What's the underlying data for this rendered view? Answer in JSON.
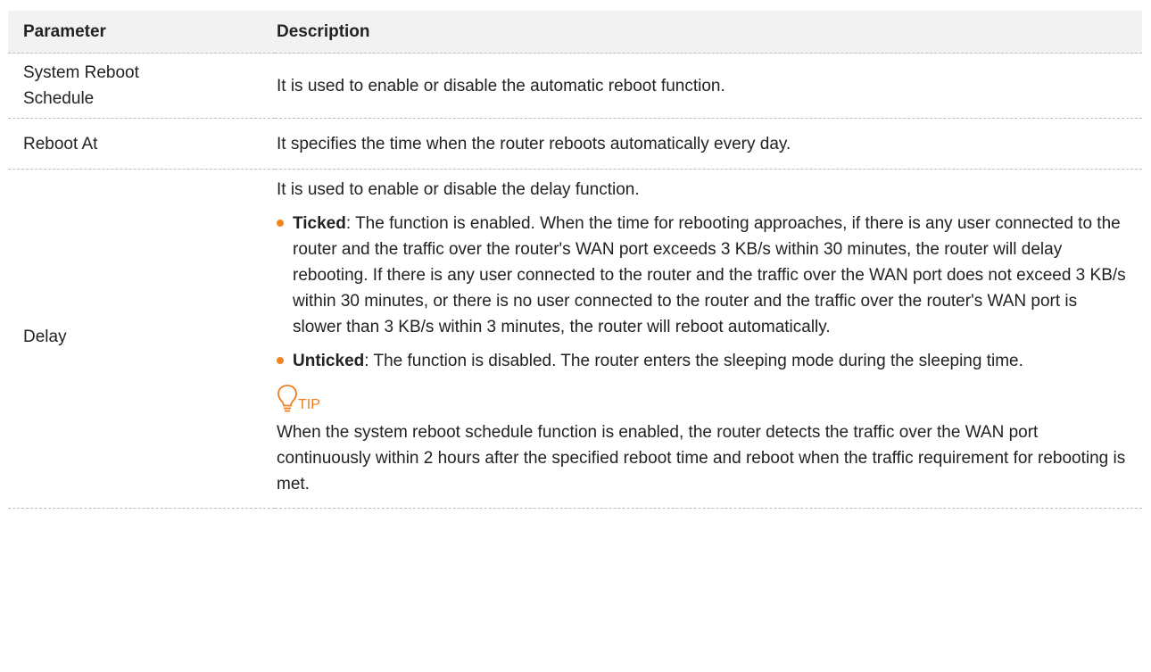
{
  "table": {
    "headers": {
      "parameter": "Parameter",
      "description": "Description"
    },
    "rows": [
      {
        "parameter": "System Reboot Schedule",
        "description": "It is used to enable or disable the automatic reboot function."
      },
      {
        "parameter": "Reboot At",
        "description": "It specifies the time when the router reboots automatically every day."
      },
      {
        "parameter": "Delay",
        "intro": "It is used to enable or disable the delay function.",
        "bullets": [
          {
            "term": "Ticked",
            "text": ": The function is enabled. When the time for rebooting approaches, if there is any user connected to the router and the traffic over the router's WAN port exceeds 3 KB/s within 30 minutes, the router will delay rebooting. If there is any user connected to the router and the traffic over the WAN port does not exceed 3 KB/s within 30 minutes, or there is no user connected to the router and the traffic over the router's WAN port is slower than 3 KB/s within 3 minutes, the router will reboot automatically."
          },
          {
            "term": "Unticked",
            "text": ": The function is disabled. The router enters the sleeping mode during the sleeping time."
          }
        ],
        "tip": {
          "label": "TIP",
          "icon": "lightbulb-icon",
          "color": "#f07d1d",
          "text": "When the system reboot schedule function is enabled, the router detects the traffic over the WAN port continuously within 2 hours after the specified reboot time and reboot when the traffic requirement for rebooting is met."
        }
      }
    ]
  },
  "colors": {
    "accent": "#f0841e",
    "header_bg": "#f2f2f2",
    "text": "#222222",
    "rule": "#bdbdbd"
  }
}
